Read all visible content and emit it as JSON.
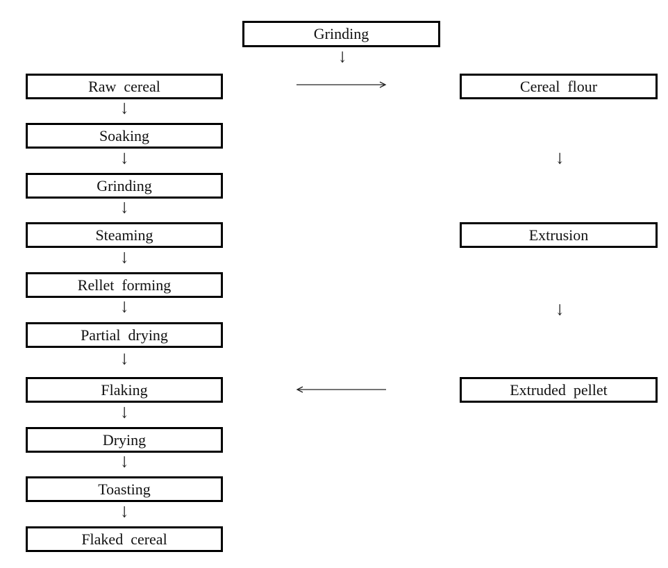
{
  "diagram": {
    "top_box": {
      "label": "Grinding"
    },
    "left_flow": [
      {
        "label": "Raw  cereal"
      },
      {
        "label": "Soaking"
      },
      {
        "label": "Grinding"
      },
      {
        "label": "Steaming"
      },
      {
        "label": "Rellet  forming"
      },
      {
        "label": "Partial  drying"
      },
      {
        "label": "Flaking"
      },
      {
        "label": "Drying"
      },
      {
        "label": "Toasting"
      },
      {
        "label": "Flaked  cereal"
      }
    ],
    "right_flow": [
      {
        "label": "Cereal  flour"
      },
      {
        "label": "Extrusion"
      },
      {
        "label": "Extruded  pellet"
      }
    ],
    "arrows": {
      "down_glyph": "↓",
      "right_connector": "Raw cereal → Cereal flour",
      "left_connector": "Extruded pellet → Flaking"
    }
  }
}
